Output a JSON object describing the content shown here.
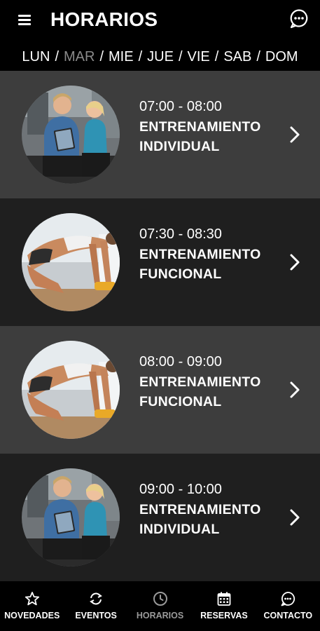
{
  "header": {
    "title": "HORARIOS",
    "menu_icon": "hamburger-menu-icon",
    "chat_icon": "chat-bubble-icon"
  },
  "days": [
    {
      "label": "LUN",
      "active": false
    },
    {
      "label": "MAR",
      "active": true
    },
    {
      "label": "MIE",
      "active": false
    },
    {
      "label": "JUE",
      "active": false
    },
    {
      "label": "VIE",
      "active": false
    },
    {
      "label": "SAB",
      "active": false
    },
    {
      "label": "DOM",
      "active": false
    }
  ],
  "day_separator": "/",
  "schedule": [
    {
      "time": "07:00 - 08:00",
      "name": "ENTRENAMIENTO INDIVIDUAL",
      "image": "trainer-couple-photo"
    },
    {
      "time": "07:30 - 08:30",
      "name": "ENTRENAMIENTO FUNCIONAL",
      "image": "woman-pushup-photo"
    },
    {
      "time": "08:00 - 09:00",
      "name": "ENTRENAMIENTO FUNCIONAL",
      "image": "woman-pushup-photo"
    },
    {
      "time": "09:00 - 10:00",
      "name": "ENTRENAMIENTO INDIVIDUAL",
      "image": "trainer-couple-photo"
    }
  ],
  "bottom_nav": [
    {
      "label": "NOVEDADES",
      "icon": "star-icon",
      "active": false
    },
    {
      "label": "EVENTOS",
      "icon": "refresh-icon",
      "active": false
    },
    {
      "label": "HORARIOS",
      "icon": "clock-icon",
      "active": true
    },
    {
      "label": "RESERVAS",
      "icon": "calendar-icon",
      "active": false
    },
    {
      "label": "CONTACTO",
      "icon": "chat-bubble-icon",
      "active": false
    }
  ],
  "colors": {
    "background": "#000000",
    "row_light": "#3d3d3d",
    "row_dark": "#1f1f1f",
    "inactive_text": "#8a8a8a",
    "text": "#ffffff"
  }
}
